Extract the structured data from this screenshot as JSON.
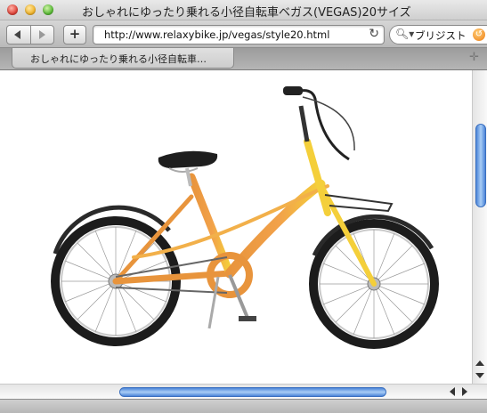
{
  "window": {
    "title": "おしゃれにゆったり乗れる小径自転車ベガス(VEGAS)20サイズ"
  },
  "toolbar": {
    "add_label": "+",
    "url": "http://www.relaxybike.jp/vegas/style20.html",
    "search_text": "ブリジスト"
  },
  "tabs": [
    {
      "label": "おしゃれにゆったり乗れる小径自転車…"
    }
  ],
  "content": {
    "image_alt": "bicycle-photo"
  },
  "colors": {
    "frame": "#f2a24a",
    "frame_front": "#f4cf3a",
    "scroll_thumb": "#5c93de"
  }
}
